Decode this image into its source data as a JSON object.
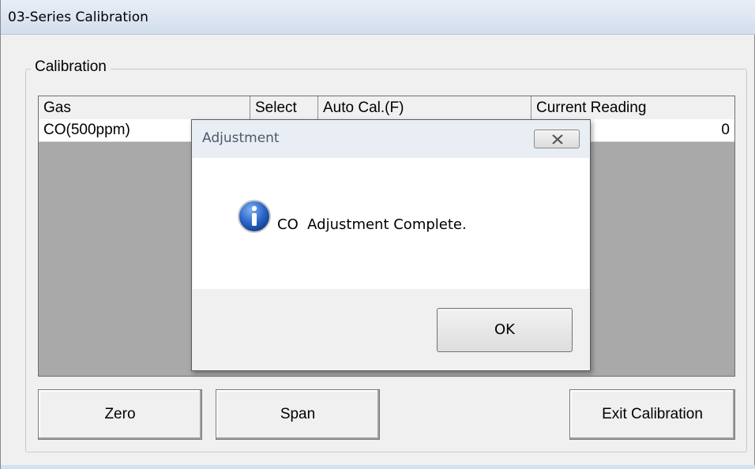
{
  "window": {
    "title": "03-Series Calibration"
  },
  "calibration_group": {
    "label": "Calibration",
    "columns": [
      "Gas",
      "Select",
      "Auto Cal.(F)",
      "Current Reading"
    ],
    "rows": [
      {
        "gas": "CO(500ppm)",
        "select": "",
        "auto_cal": "",
        "current_reading": "0"
      }
    ]
  },
  "buttons": {
    "zero": "Zero",
    "span": "Span",
    "exit": "Exit Calibration"
  },
  "dialog": {
    "title": "Adjustment",
    "message": "CO  Adjustment Complete.",
    "ok": "OK",
    "icon": "info-icon",
    "close_icon": "close-icon"
  },
  "colors": {
    "window_bg": "#f0f0f0",
    "grid_bg": "#a9a9a9",
    "info_icon_blue": "#1f5fbf"
  }
}
